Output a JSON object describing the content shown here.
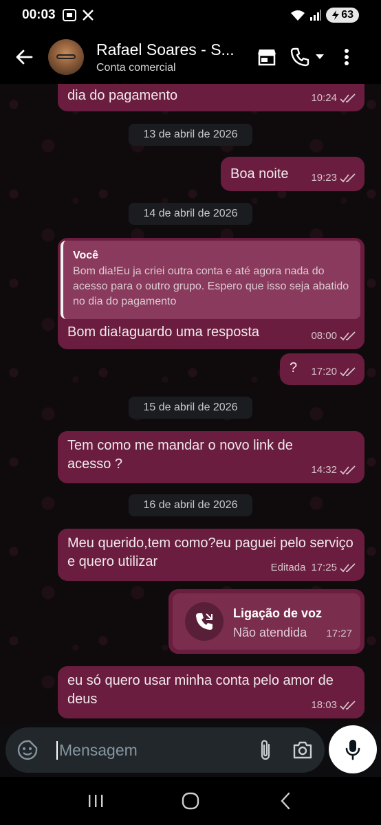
{
  "status_bar": {
    "time": "00:03",
    "battery": "63"
  },
  "header": {
    "contact_name": "Rafael Soares - S...",
    "subtitle": "Conta comercial"
  },
  "messages": [
    {
      "text": "dia do pagamento",
      "time": "10:24"
    },
    {
      "date": "13 de abril de 2026"
    },
    {
      "text": "Boa noite",
      "time": "19:23"
    },
    {
      "date": "14 de abril de 2026"
    },
    {
      "quote_author": "Você",
      "quote_text": "Bom dia!Eu ja criei outra conta e até agora nada do acesso para o outro grupo. Espero que isso seja abatido no dia do pagamento",
      "text": "Bom dia!aguardo uma resposta",
      "time": "08:00"
    },
    {
      "text": "?",
      "time": "17:20"
    },
    {
      "date": "15 de abril de 2026"
    },
    {
      "text": "Tem como me mandar o novo link de acesso ?",
      "time": "14:32"
    },
    {
      "date": "16 de abril de 2026"
    },
    {
      "text": "Meu querido,tem como?eu paguei pelo serviço e quero utilizar",
      "edited": "Editada",
      "time": "17:25"
    },
    {
      "call_title": "Ligação de voz",
      "call_status": "Não atendida",
      "time": "17:27"
    },
    {
      "text": "eu só quero usar minha conta pelo amor de deus",
      "time": "18:03"
    }
  ],
  "input": {
    "placeholder": "Mensagem"
  },
  "colors": {
    "bubble": "#6a1d3e",
    "header": "#000000",
    "chip": "#1a1c1f"
  }
}
